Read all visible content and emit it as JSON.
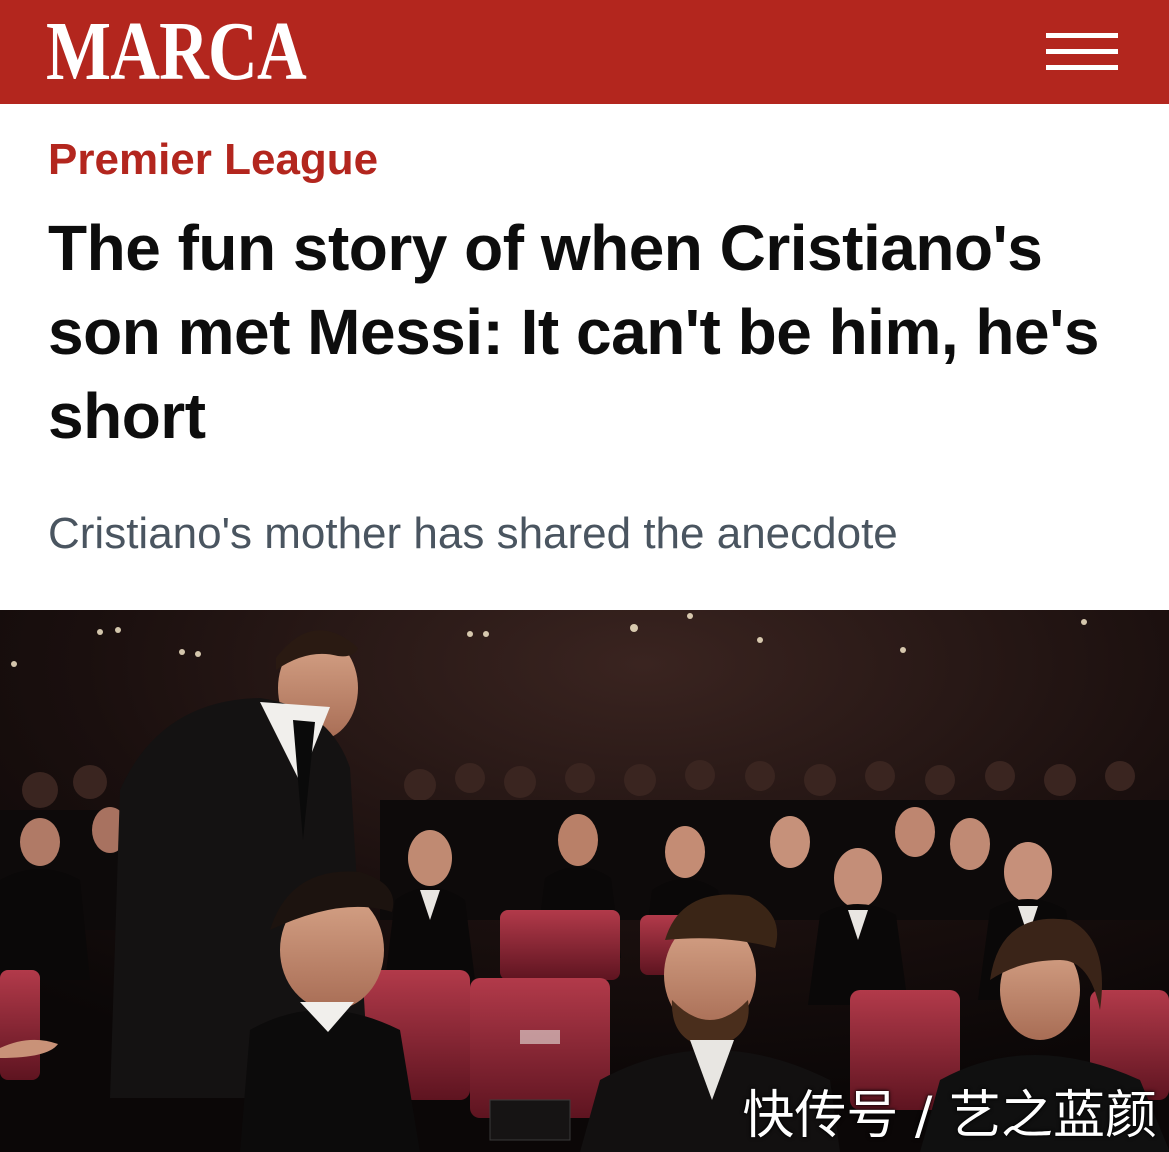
{
  "header": {
    "logo": "MARCA",
    "menu_icon": "hamburger-menu-icon",
    "brand_color": "#b3261e"
  },
  "article": {
    "category": "Premier League",
    "headline": "The fun story of when Cristiano's son met Messi: It can't be him, he's short",
    "subheadline": "Cristiano's mother has shared the anecdote"
  },
  "photo": {
    "watermark": "快传号 / 艺之蓝颜"
  }
}
